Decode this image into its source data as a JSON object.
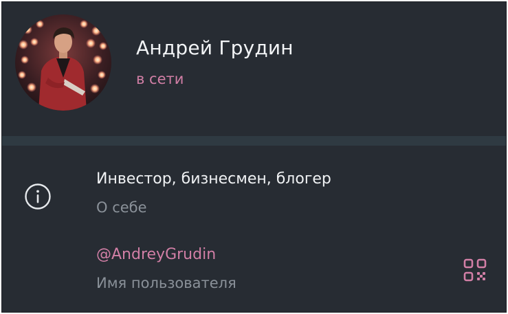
{
  "profile": {
    "name": "Андрей Грудин",
    "status": "в сети",
    "avatar_icon": "user-avatar-photo"
  },
  "info": {
    "bio": "Инвестор, бизнесмен, блогер",
    "bio_caption": "О себе",
    "username": "@AndreyGrudin",
    "username_caption": "Имя пользователя",
    "info_icon": "info-icon",
    "qr_icon": "qr-code-icon"
  },
  "colors": {
    "background": "#272c33",
    "divider": "#2f3a42",
    "accent": "#d27fa6",
    "text_primary": "#f0f2f4",
    "text_secondary": "#8a9199"
  }
}
